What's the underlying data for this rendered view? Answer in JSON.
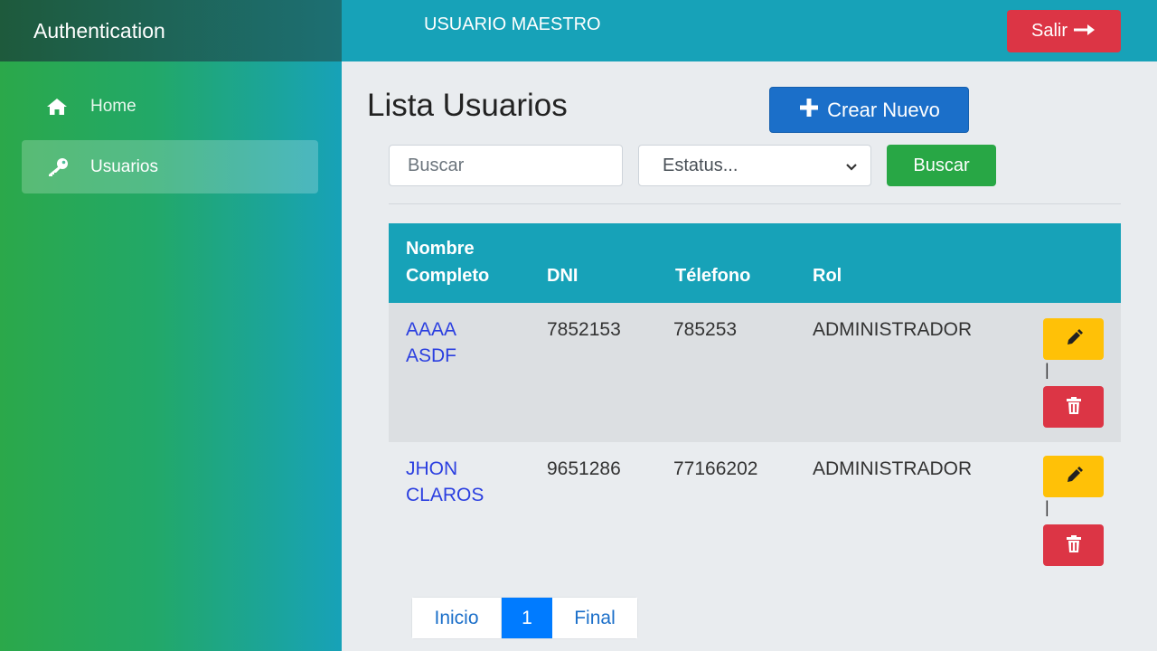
{
  "sidebar": {
    "brand": "Authentication",
    "items": [
      {
        "label": "Home",
        "icon": "home-icon"
      },
      {
        "label": "Usuarios",
        "icon": "key-icon"
      }
    ]
  },
  "topbar": {
    "title": "USUARIO MAESTRO",
    "logout_label": "Salir"
  },
  "main": {
    "page_title": "Lista Usuarios",
    "create_label": "Crear Nuevo",
    "search": {
      "placeholder": "Buscar",
      "value": ""
    },
    "status_select": {
      "selected": "Estatus..."
    },
    "search_button": "Buscar"
  },
  "table": {
    "headers": {
      "name_line1": "Nombre",
      "name_line2": "Completo",
      "dni": "DNI",
      "phone": "Télefono",
      "role": "Rol"
    },
    "rows": [
      {
        "name_line1": "AAAA",
        "name_line2": "ASDF",
        "dni": "7852153",
        "phone": "785253",
        "role": "ADMINISTRADOR",
        "separator": "|"
      },
      {
        "name_line1": "JHON",
        "name_line2": "CLAROS",
        "dni": "9651286",
        "phone": "77166202",
        "role": "ADMINISTRADOR",
        "separator": "|"
      }
    ]
  },
  "pagination": {
    "first": "Inicio",
    "current": "1",
    "last": "Final"
  },
  "colors": {
    "accent": "#17a2b8",
    "danger": "#dc3545",
    "warning": "#ffc107",
    "success": "#28a745",
    "primary": "#007bff"
  }
}
